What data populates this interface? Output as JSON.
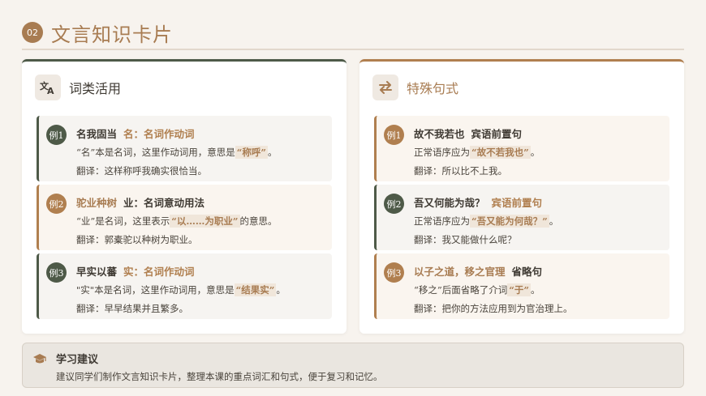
{
  "header": {
    "number": "02",
    "title": "文言知识卡片"
  },
  "left_panel": {
    "icon": "translate-icon",
    "title": "词类活用",
    "cards": [
      {
        "badge": "例1",
        "phrase": "名我固当",
        "tag": "名：名词作动词",
        "explain_pre": "“名”本是名词，这里作动词用，意思是",
        "explain_hl": "“称呼”",
        "explain_post": "。",
        "translation": "翻译：这样称呼我确实很恰当。"
      },
      {
        "badge": "例2",
        "phrase": "驼业种树",
        "tag": "业：名词意动用法",
        "explain_pre": "“业”是名词，这里表示",
        "explain_hl": "“以……为职业”",
        "explain_post": "的意思。",
        "translation": "翻译：郭橐驼以种树为职业。"
      },
      {
        "badge": "例3",
        "phrase": "早实以蕃",
        "tag": "实：名词作动词",
        "explain_pre": "\"实\"本是名词，这里作动词用，意思是",
        "explain_hl": "“结果实”",
        "explain_post": "。",
        "translation": "翻译：早早结果并且繁多。"
      }
    ]
  },
  "right_panel": {
    "icon": "swap-arrows-icon",
    "title": "特殊句式",
    "cards": [
      {
        "badge": "例1",
        "phrase": "故不我若也",
        "tag": "宾语前置句",
        "explain_pre": "正常语序应为",
        "explain_hl": "“故不若我也”",
        "explain_post": "。",
        "translation": "翻译：所以比不上我。"
      },
      {
        "badge": "例2",
        "phrase": "吾又何能为哉？",
        "tag": "宾语前置句",
        "explain_pre": "正常语序应为",
        "explain_hl": "“吾又能为何哉？”",
        "explain_post": "。",
        "translation": "翻译：我又能做什么呢？"
      },
      {
        "badge": "例3",
        "phrase": "以子之道，移之官理",
        "tag": "省略句",
        "explain_pre": "“移之”后面省略了介词",
        "explain_hl": "“于”",
        "explain_post": "。",
        "translation": "翻译：把你的方法应用到为官治理上。"
      }
    ]
  },
  "tip": {
    "icon": "graduation-cap-icon",
    "title": "学习建议",
    "text": "建议同学们制作文言知识卡片，整理本课的重点词汇和句式，便于复习和记忆。"
  },
  "colors": {
    "accent_brown": "#a87c52",
    "accent_green": "#4e5a48",
    "background": "#f7f3ee"
  }
}
